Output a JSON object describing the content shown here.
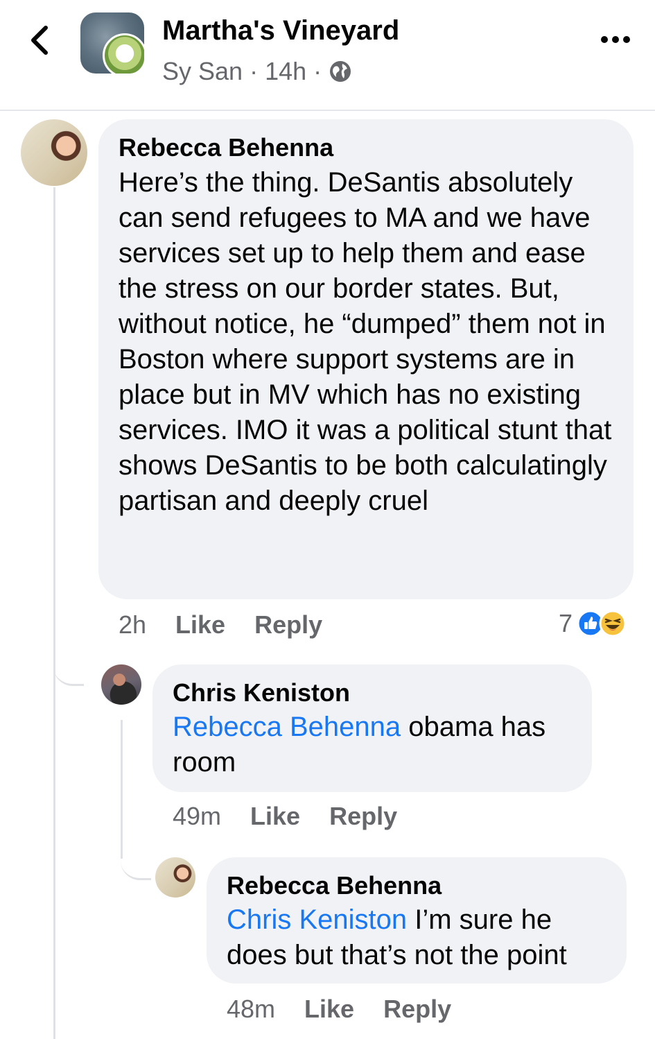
{
  "header": {
    "group_name": "Martha's Vineyard",
    "author": "Sy San",
    "separator": "·",
    "time": "14h"
  },
  "comments": [
    {
      "author": "Rebecca Behenna",
      "text": "Here’s the thing. DeSantis absolutely can send refugees to MA and we have services set up to help them and ease the stress on our border states. But, without notice, he “dumped” them not in Boston where support systems are in place but in MV which has no existing services. IMO it was a political stunt that shows DeSantis to be both calculatingly partisan and deeply cruel",
      "time": "2h",
      "like_label": "Like",
      "reply_label": "Reply",
      "reaction_count": "7",
      "reactions": [
        "like-icon",
        "haha-icon"
      ]
    },
    {
      "author": "Chris Keniston",
      "mention": "Rebecca Behenna",
      "text": " obama has room",
      "time": "49m",
      "like_label": "Like",
      "reply_label": "Reply"
    },
    {
      "author": "Rebecca Behenna",
      "mention": "Chris Keniston",
      "text": " I’m sure he does but that’s not the point",
      "time": "48m",
      "like_label": "Like",
      "reply_label": "Reply"
    }
  ],
  "colors": {
    "bubble": "#f0f2f5",
    "mention": "#1877f2",
    "meta": "#65676b",
    "like": "#1877f2",
    "haha": "#f7c23c"
  }
}
